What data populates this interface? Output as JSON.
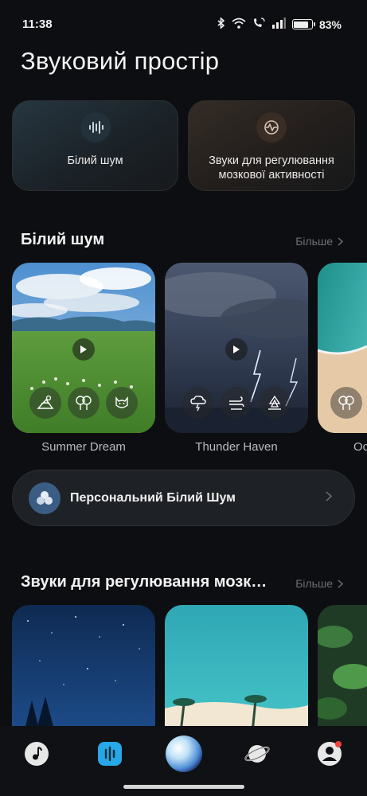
{
  "status_bar": {
    "time": "11:38",
    "battery_percent": "83%",
    "battery_level": 0.83
  },
  "page_title": "Звуковий простір",
  "categories": [
    {
      "label": "Білий шум",
      "icon": "soundwave-icon"
    },
    {
      "label": "Звуки для регулювання мозкової активності",
      "icon": "pulse-icon"
    }
  ],
  "white_noise_section": {
    "title": "Білий шум",
    "more_label": "Більше",
    "cards": [
      {
        "name": "Summer Dream",
        "chips": [
          "picnic-icon",
          "trees-rain-icon",
          "cat-icon"
        ]
      },
      {
        "name": "Thunder Haven",
        "chips": [
          "storm-cloud-icon",
          "wind-field-icon",
          "campfire-icon"
        ]
      },
      {
        "name": "Oc",
        "chips": [
          "trees-rain-icon"
        ]
      }
    ]
  },
  "personal_white_noise": {
    "label": "Персональний Білий Шум"
  },
  "brain_section": {
    "title": "Звуки для регулювання мозк…",
    "more_label": "Більше"
  },
  "bottom_nav": [
    "music-note-icon",
    "sound-bars-icon",
    "orb-icon",
    "planet-icon",
    "profile-icon"
  ],
  "colors": {
    "accent_blue": "#27a7e8",
    "badge_red": "#f0443a",
    "background": "#0d0e11"
  }
}
